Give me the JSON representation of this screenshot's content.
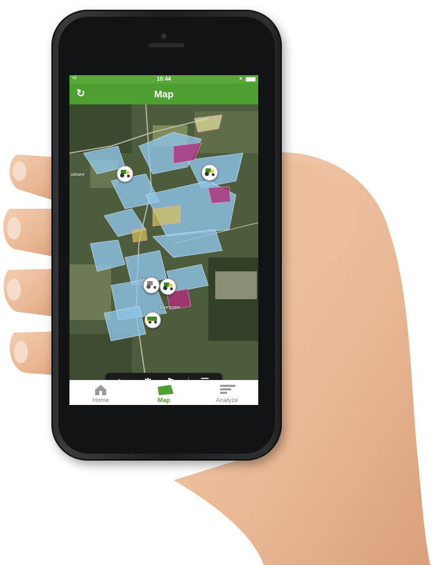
{
  "status_bar": {
    "time": "10:44",
    "signal": "•ıl",
    "location": "➤"
  },
  "nav": {
    "title": "Map",
    "refresh_icon": "refresh-icon"
  },
  "map": {
    "place_labels": [
      "witsee",
      "Beetzsee",
      "Beetzsee"
    ],
    "markers": [
      "tractor-icon",
      "tractor-icon",
      "tractor-icon",
      "tractor-icon",
      "combine-harvester-icon"
    ]
  },
  "toolbar": {
    "items": [
      "navigation-arrow-icon",
      "gear-icon",
      "flag-add-icon",
      "list-icon"
    ],
    "flag_label": "+"
  },
  "tabs": [
    {
      "label": "Home",
      "icon": "home-icon",
      "active": false
    },
    {
      "label": "Map",
      "icon": "field-map-icon",
      "active": true
    },
    {
      "label": "Analyze",
      "icon": "bars-icon",
      "active": false
    }
  ],
  "colors": {
    "brand_green": "#4f9e31",
    "field_blue": "#8fc4e8",
    "field_magenta": "#b0307a"
  }
}
